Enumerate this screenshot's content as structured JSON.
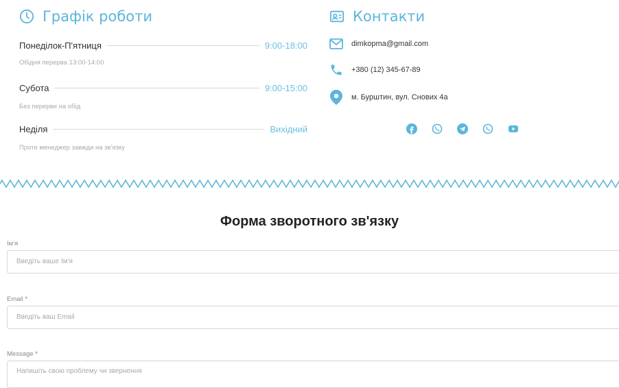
{
  "schedule": {
    "title": "Графік роботи",
    "rows": [
      {
        "day": "Понеділок-П'ятниця",
        "time": "9:00-18:00",
        "note": "Обідня перерва 13:00-14:00"
      },
      {
        "day": "Субота",
        "time": "9:00-15:00",
        "note": "Без перерви на обід"
      },
      {
        "day": "Неділя",
        "time": "Вихідний",
        "note": "Проте менеджер завжди на зв'язку"
      }
    ]
  },
  "contacts": {
    "title": "Контакти",
    "email": "dimkopma@gmail.com",
    "phone": "+380 (12) 345-67-89",
    "address": "м. Бурштин, вул. Снових 4а",
    "socials": [
      "facebook-icon",
      "whatsapp-icon",
      "telegram-icon",
      "viber-icon",
      "youtube-icon"
    ]
  },
  "colors": {
    "accent": "#5bb5dc"
  },
  "form": {
    "title": "Форма зворотного зв'язку",
    "name_label": "Ім'я",
    "name_placeholder": "Введіть ваше Ім'я",
    "email_label": "Email",
    "email_placeholder": "Введіть ваш Email",
    "message_label": "Message",
    "message_placeholder": "Напишіть свою проблему чи звернення",
    "required_mark": "*"
  }
}
